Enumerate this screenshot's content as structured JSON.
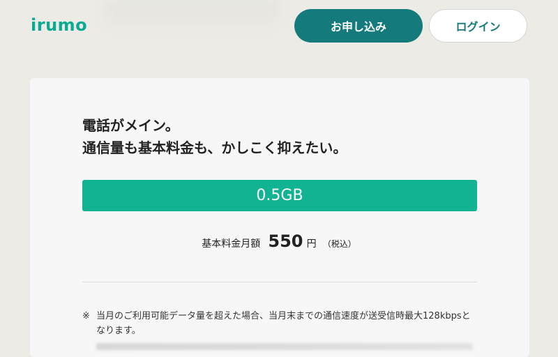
{
  "header": {
    "logo": "irumo",
    "apply_button": "お申し込み",
    "login_button": "ログイン"
  },
  "card": {
    "headline_line1": "電話がメイン。",
    "headline_line2": "通信量も基本料金も、かしこく抑えたい。",
    "plan": "0.5GB",
    "price_label": "基本料金月額",
    "price_value": "550",
    "price_unit": "円",
    "price_tax": "（税込）",
    "note_mark": "※",
    "note_text": "当月のご利用可能データ量を超えた場合、当月末までの通信速度が送受信時最大128kbpsとなります。"
  },
  "colors": {
    "brand": "#0bab93",
    "primary_button": "#157a7b",
    "plan_bar": "#12b392"
  }
}
